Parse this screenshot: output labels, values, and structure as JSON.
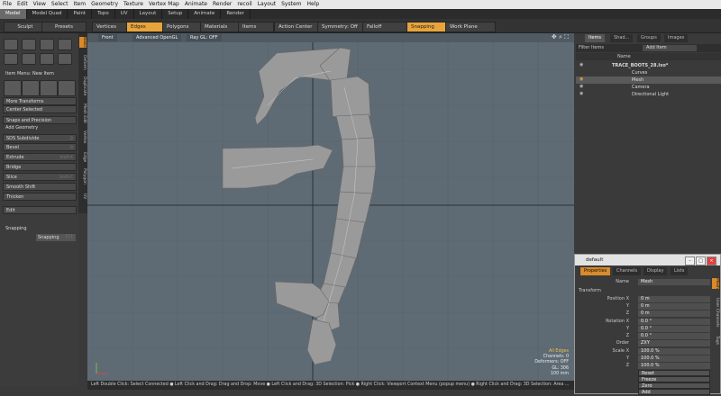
{
  "menu": [
    "File",
    "Edit",
    "View",
    "Select",
    "Item",
    "Geometry",
    "Texture",
    "Vertex Map",
    "Animate",
    "Render",
    "recoil",
    "Layout",
    "System",
    "Help"
  ],
  "mode_tabs": [
    "Model",
    "Model Quad",
    "Paint",
    "Topo",
    "UV",
    "Layout",
    "Setup",
    "Animate",
    "Render"
  ],
  "toolbar": {
    "sculpt": "Sculpt",
    "presets": "Presets",
    "vertices": "Vertices",
    "edges": "Edges",
    "polygons": "Polygons",
    "materials": "Materials",
    "items": "Items",
    "action_center": "Action Center",
    "symmetry": "Symmetry: Off",
    "falloff": "Falloff",
    "snapping": "Snapping",
    "work_plane": "Work Plane"
  },
  "left_panel": {
    "item_menu": "Item Menu: New Item",
    "more_transforms": "More Transforms",
    "center_selected": "Center Selected",
    "snaps_and_precision": "Snaps and Precision",
    "add_geometry": "Add Geometry",
    "tools": [
      {
        "label": "SDS Subdivide",
        "shortcut": "D"
      },
      {
        "label": "Bevel",
        "shortcut": "B"
      },
      {
        "label": "Extrude",
        "shortcut": "Shift-X"
      },
      {
        "label": "Bridge",
        "shortcut": ""
      },
      {
        "label": "Slice",
        "shortcut": "Shift-C"
      },
      {
        "label": "Smooth Shift",
        "shortcut": ""
      },
      {
        "label": "Thicken",
        "shortcut": ""
      }
    ],
    "edit": "Edit",
    "snapping_header": "Snapping",
    "snapping_button": "Snapping",
    "snapping_shortcut": "F11",
    "side_tabs": [
      "Basic",
      "Deform",
      "Duplicate",
      "Mesh Edit",
      "Vertex",
      "Edge",
      "Polygon",
      "UV"
    ]
  },
  "viewport": {
    "front": "Front",
    "shading": "Advanced OpenGL",
    "raygl": "Ray GL: OFF",
    "readout": [
      "All Edges",
      "Channels: 0",
      "Deformers: OFF",
      "GL: 306",
      "100 mm"
    ]
  },
  "status_bar": "Left Double Click: Select Connected ● Left Click and Drag: Drag and Drop: Move ● Left Click and Drag: 3D Selection: Pick ● Right Click: Viewport Context Menu (popup menu) ● Right Click and Drag: 3D Selection: Area ...",
  "items_panel": {
    "tabs": [
      "Items",
      "Shad...",
      "Groups",
      "Images"
    ],
    "filter": "Filter Items",
    "add_item": "Add Item",
    "col_name": "Name",
    "rows": [
      {
        "label": "TRACE_BOOTS_28.lxo*",
        "indent": 0
      },
      {
        "label": "Curves",
        "indent": 1
      },
      {
        "label": "Mesh",
        "indent": 1
      },
      {
        "label": "Camera",
        "indent": 1
      },
      {
        "label": "Directional Light",
        "indent": 1
      }
    ]
  },
  "properties_window": {
    "title": "default",
    "tabs": [
      "Properties",
      "Channels",
      "Display",
      "Lists"
    ],
    "name_label": "Name",
    "name_value": "Mesh",
    "transform": "Transform",
    "fields": [
      {
        "label": "Position X",
        "value": "0 m"
      },
      {
        "label": "Y",
        "value": "0 m"
      },
      {
        "label": "Z",
        "value": "0 m"
      },
      {
        "label": "Rotation X",
        "value": "0.0 °"
      },
      {
        "label": "Y",
        "value": "0.0 °"
      },
      {
        "label": "Z",
        "value": "0.0 °"
      },
      {
        "label": "Order",
        "value": "ZXY"
      },
      {
        "label": "Scale X",
        "value": "100.0 %"
      },
      {
        "label": "Y",
        "value": "100.0 %"
      },
      {
        "label": "Z",
        "value": "100.0 %"
      }
    ],
    "buttons": [
      "Reset",
      "Freeze",
      "Zero",
      "Add"
    ],
    "side_tabs": [
      "Mesh",
      "User Channels",
      "Tags"
    ]
  }
}
